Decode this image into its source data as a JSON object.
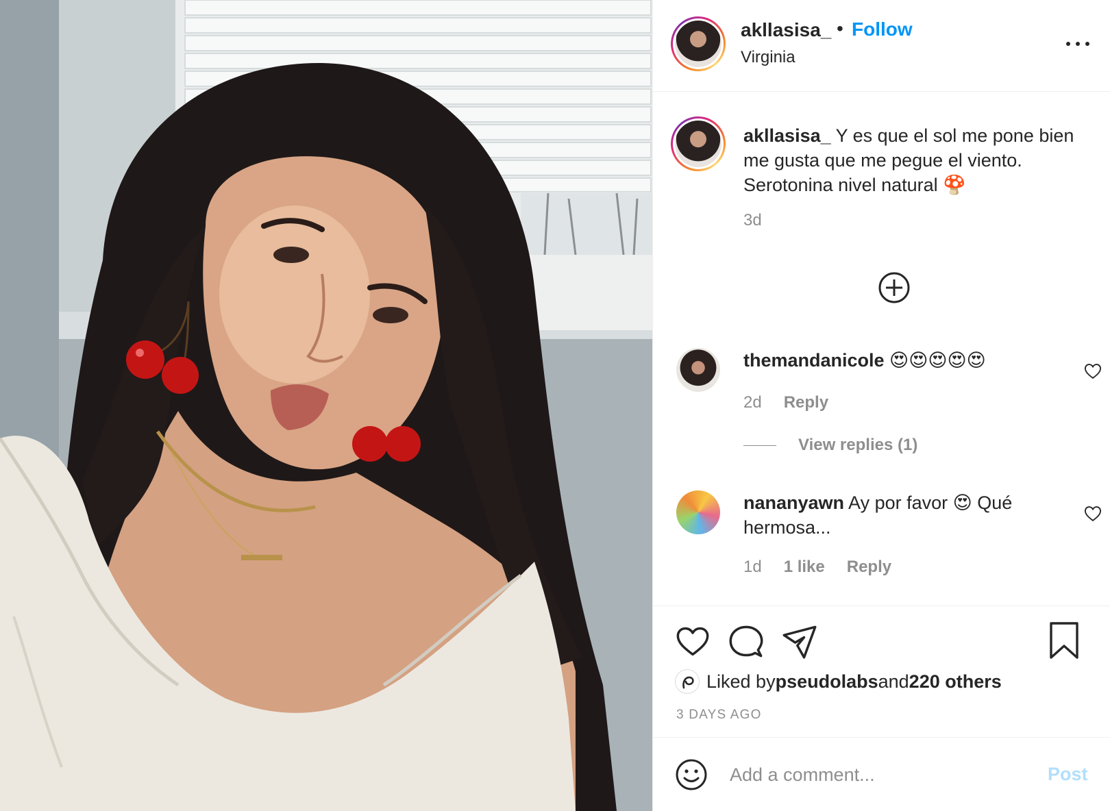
{
  "post": {
    "photo_label": "selfie-photo"
  },
  "header": {
    "username": "akllasisa_",
    "separator": "•",
    "follow_label": "Follow",
    "location": "Virginia",
    "more_icon": "more-horizontal-icon"
  },
  "caption": {
    "username": "akllasisa_",
    "text": " Y es que el sol me pone bien me gusta que me pegue el viento. Serotonina nivel natural 🍄",
    "time": "3d"
  },
  "add_more_icon": "plus-circle-icon",
  "comments": [
    {
      "username": "themandanicole",
      "text": " 😍😍😍😍😍",
      "time": "2d",
      "likes": "",
      "reply_label": "Reply",
      "view_replies": "View replies (1)"
    },
    {
      "username": "nananyawn",
      "text": " Ay por favor 😍 Qué hermosa...",
      "time": "1d",
      "likes": "1 like",
      "reply_label": "Reply"
    }
  ],
  "actions": {
    "like_icon": "heart-icon",
    "comment_icon": "comment-icon",
    "share_icon": "paper-plane-icon",
    "save_icon": "bookmark-icon"
  },
  "likes": {
    "prefix": "Liked by ",
    "user": "pseudolabs",
    "middle": " and ",
    "others": "220 others"
  },
  "posted": "3 DAYS AGO",
  "add_comment": {
    "placeholder": "Add a comment...",
    "post_label": "Post",
    "emoji_icon": "smiley-icon"
  },
  "colors": {
    "follow_blue": "#0095f6",
    "post_disabled": "#b2dffc",
    "muted_text": "#8e8e8e",
    "divider": "#efefef"
  }
}
